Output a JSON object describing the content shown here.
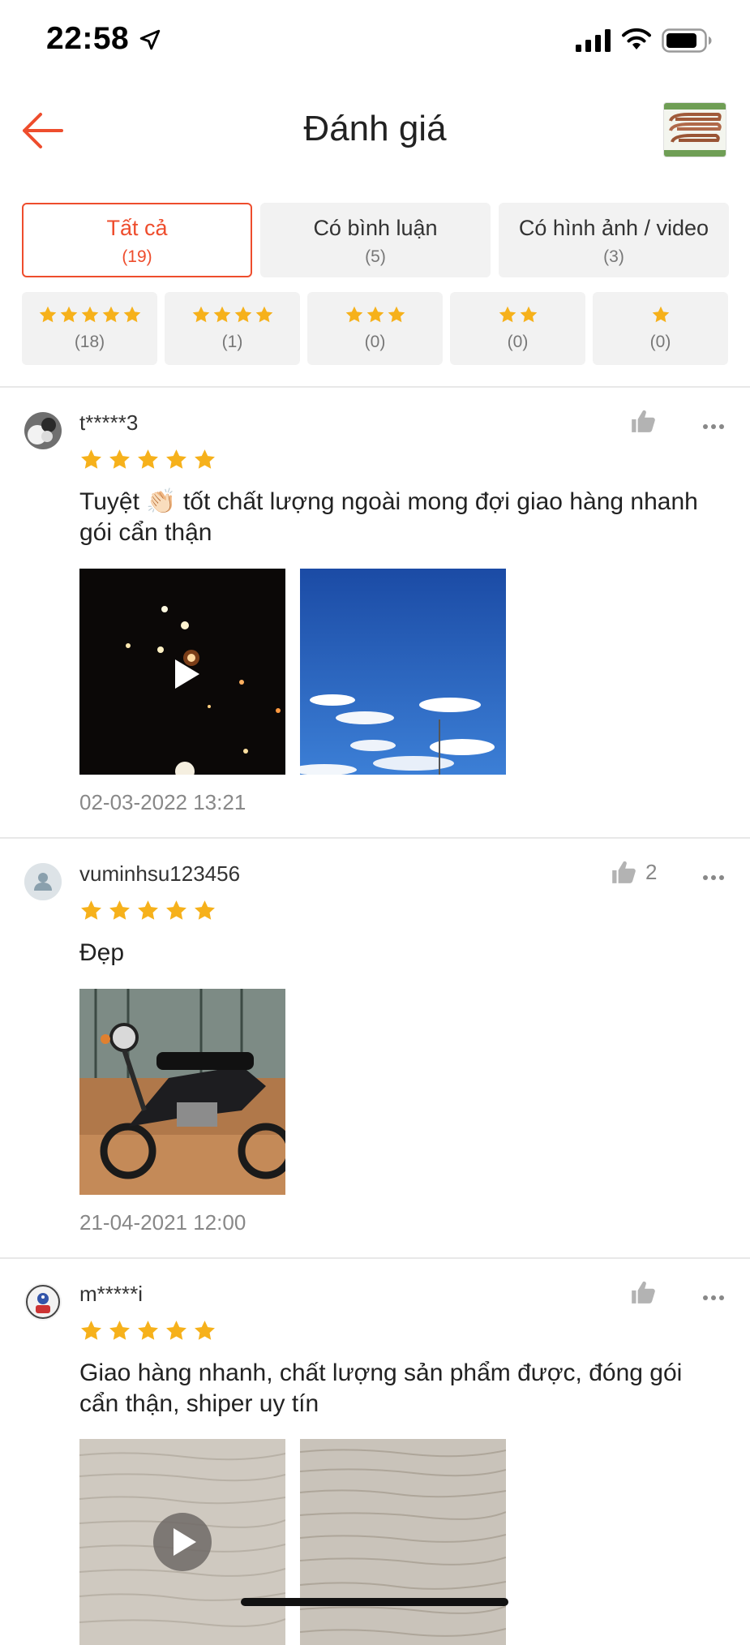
{
  "status_bar": {
    "time": "22:58"
  },
  "header": {
    "title": "Đánh giá"
  },
  "filters": [
    {
      "label": "Tất cả",
      "count": "(19)",
      "active": true
    },
    {
      "label": "Có bình luận",
      "count": "(5)",
      "active": false
    },
    {
      "label": "Có hình ảnh / video",
      "count": "(3)",
      "active": false
    }
  ],
  "star_filters": [
    {
      "stars": 5,
      "count": "(18)"
    },
    {
      "stars": 4,
      "count": "(1)"
    },
    {
      "stars": 3,
      "count": "(0)"
    },
    {
      "stars": 2,
      "count": "(0)"
    },
    {
      "stars": 1,
      "count": "(0)"
    }
  ],
  "colors": {
    "accent": "#ee4d2d",
    "star": "#f6b11b",
    "muted": "#888888"
  },
  "reviews": [
    {
      "username": "t*****3",
      "rating": 5,
      "text": "Tuyệt 👏🏻 tốt chất lượng ngoài mong đợi giao hàng nhanh gói cẩn thận",
      "media": [
        "video-night-lights",
        "photo-blue-sky"
      ],
      "date": "02-03-2022 13:21",
      "likes": ""
    },
    {
      "username": "vuminhsu123456",
      "rating": 5,
      "text": "Đẹp",
      "media": [
        "photo-motorbike"
      ],
      "date": "21-04-2021 12:00",
      "likes": "2"
    },
    {
      "username": "m*****i",
      "rating": 5,
      "text": "Giao hàng nhanh, chất lượng sản phẩm được, đóng gói cẩn thận, shiper uy tín",
      "media": [
        "video-wood-surface",
        "photo-wood-surface"
      ],
      "date": "",
      "likes": ""
    }
  ]
}
